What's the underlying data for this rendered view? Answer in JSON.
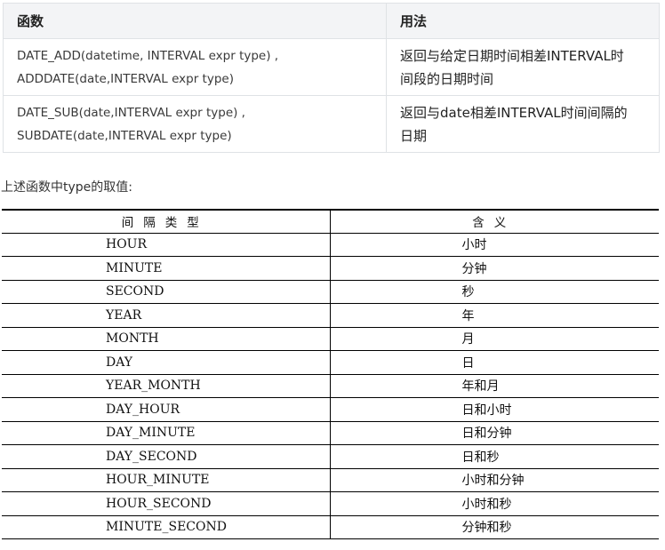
{
  "function_table": {
    "headers": [
      "函数",
      "用法"
    ],
    "rows": [
      {
        "function_lines": [
          "DATE_ADD(datetime, INTERVAL expr type) ,",
          "ADDDATE(date,INTERVAL expr type)"
        ],
        "usage_lines": [
          "返回与给定日期时间相差INTERVAL时",
          "间段的日期时间"
        ]
      },
      {
        "function_lines": [
          "DATE_SUB(date,INTERVAL expr type) ,",
          "SUBDATE(date,INTERVAL expr type)"
        ],
        "usage_lines": [
          "返回与date相差INTERVAL时间间隔的",
          "日期"
        ]
      }
    ]
  },
  "intro_text": "上述函数中type的取值:",
  "type_table": {
    "headers": [
      "间隔类型",
      "含义"
    ],
    "rows": [
      [
        "HOUR",
        "小时"
      ],
      [
        "MINUTE",
        "分钟"
      ],
      [
        "SECOND",
        "秒"
      ],
      [
        "YEAR",
        "年"
      ],
      [
        "MONTH",
        "月"
      ],
      [
        "DAY",
        "日"
      ],
      [
        "YEAR_MONTH",
        "年和月"
      ],
      [
        "DAY_HOUR",
        "日和小时"
      ],
      [
        "DAY_MINUTE",
        "日和分钟"
      ],
      [
        "DAY_SECOND",
        "日和秒"
      ],
      [
        "HOUR_MINUTE",
        "小时和分钟"
      ],
      [
        "HOUR_SECOND",
        "小时和秒"
      ],
      [
        "MINUTE_SECOND",
        "分钟和秒"
      ]
    ]
  }
}
